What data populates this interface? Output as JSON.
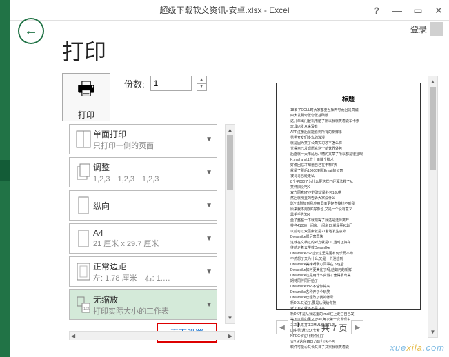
{
  "titlebar": "超级下载软文资讯-安卓.xlsx - Excel",
  "login": "登录",
  "page_title": "打印",
  "print_label": "打印",
  "copies_label": "份数:",
  "copies_value": "1",
  "settings": [
    {
      "title": "单面打印",
      "sub": "只打印一侧的页面"
    },
    {
      "title": "调整",
      "sub": "1,2,3　1,2,3　1,2,3"
    },
    {
      "title": "纵向",
      "sub": ""
    },
    {
      "title": "A4",
      "sub": "21 厘米 x 29.7 厘米"
    },
    {
      "title": "正常边距",
      "sub": "左: 1.78 厘米　右: 1.…"
    },
    {
      "title": "无缩放",
      "sub": "打印实际大小的工作表"
    }
  ],
  "page_setup": "页面设置",
  "preview_title": "标题",
  "pager": {
    "current": "1",
    "total": "共 7 页"
  },
  "watermark": {
    "a": "xue",
    "b": "xila",
    "c": ".com"
  }
}
